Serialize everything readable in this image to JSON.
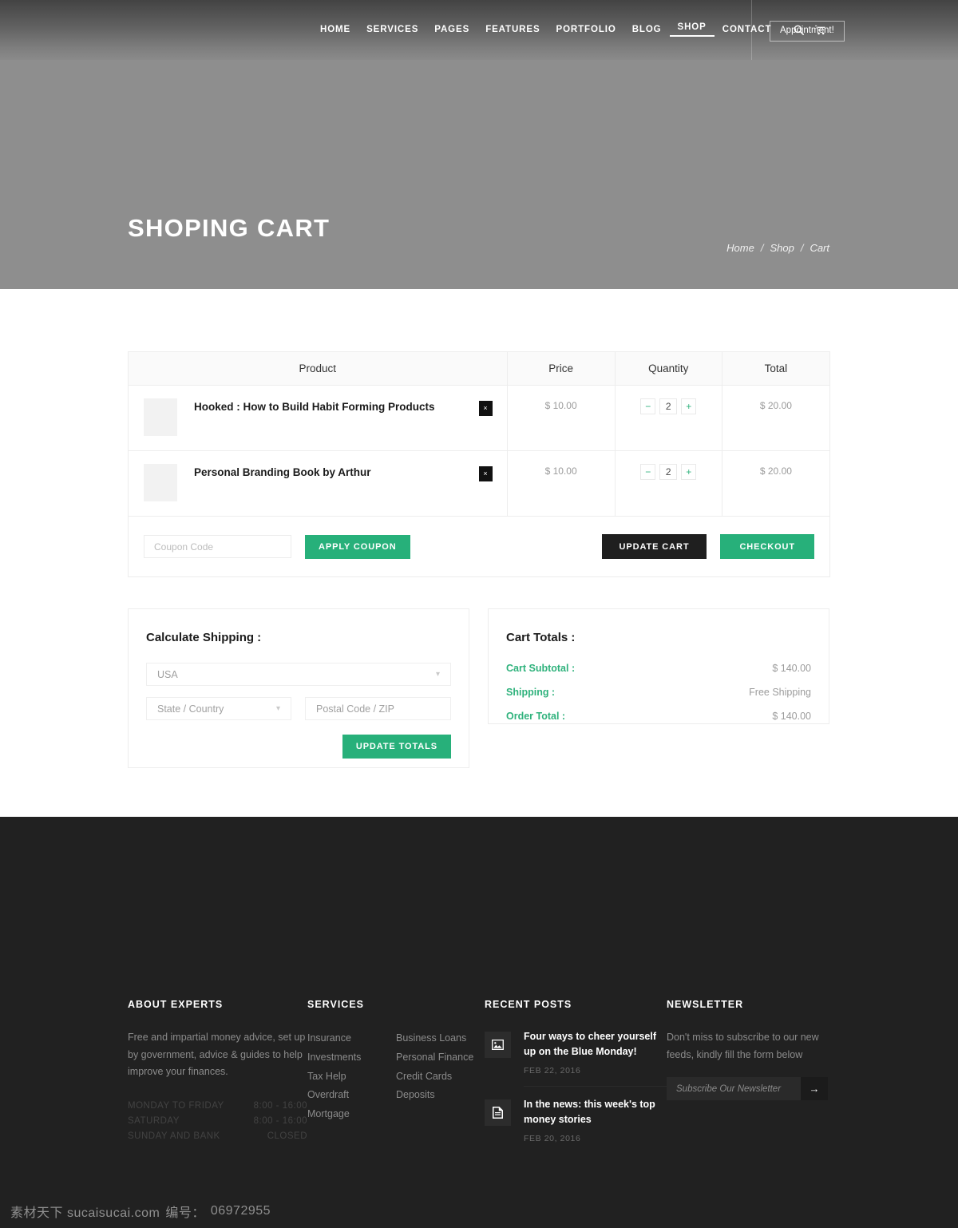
{
  "header": {
    "nav": [
      {
        "label": "HOME",
        "active": false
      },
      {
        "label": "SERVICES",
        "active": false
      },
      {
        "label": "PAGES",
        "active": false
      },
      {
        "label": "FEATURES",
        "active": false
      },
      {
        "label": "PORTFOLIO",
        "active": false
      },
      {
        "label": "BLOG",
        "active": false
      },
      {
        "label": "SHOP",
        "active": true
      },
      {
        "label": "CONTACT",
        "active": false
      }
    ],
    "search_icon": "search-icon",
    "cart_icon": "cart-icon",
    "appointment_label": "Appointment!"
  },
  "hero": {
    "title": "SHOPING CART",
    "breadcrumb": [
      {
        "label": "Home"
      },
      {
        "label": "Shop"
      },
      {
        "label": "Cart"
      }
    ],
    "separator": "/"
  },
  "cart": {
    "columns": [
      "Product",
      "Price",
      "Quantity",
      "Total"
    ],
    "items": [
      {
        "name": "Hooked : How to Build Habit Forming Products",
        "price": "$ 10.00",
        "quantity": "2",
        "total": "$ 20.00",
        "remove_label": "×",
        "decrement_label": "−",
        "increment_label": "+"
      },
      {
        "name": "Personal Branding Book by Arthur",
        "price": "$ 10.00",
        "quantity": "2",
        "total": "$ 20.00",
        "remove_label": "×",
        "decrement_label": "−",
        "increment_label": "+"
      }
    ],
    "coupon_placeholder": "Coupon Code",
    "coupon_value": "",
    "apply_coupon_label": "APPLY COUPON",
    "update_cart_label": "UPDATE CART",
    "checkout_label": "CHECKOUT"
  },
  "shipping": {
    "title": "Calculate Shipping :",
    "country_value": "USA",
    "state_value": "State / Country",
    "postal_placeholder": "Postal Code / ZIP",
    "postal_value": "",
    "update_totals_label": "UPDATE TOTALS"
  },
  "totals": {
    "title": "Cart Totals :",
    "rows": [
      {
        "label": "Cart Subtotal :",
        "value": "$ 140.00"
      },
      {
        "label": "Shipping :",
        "value": "Free Shipping"
      },
      {
        "label": "Order Total :",
        "value": "$ 140.00"
      }
    ]
  },
  "footer": {
    "about": {
      "heading": "ABOUT EXPERTS",
      "text": "Free and impartial money advice, set up by government, advice & guides to help improve your finances.",
      "hours": [
        {
          "day": "MONDAY TO FRIDAY",
          "time": "8:00 - 16:00"
        },
        {
          "day": "SATURDAY",
          "time": "8:00 - 16:00"
        },
        {
          "day": "SUNDAY AND BANK",
          "time": "CLOSED"
        }
      ]
    },
    "services": {
      "heading": "SERVICES",
      "list_left": [
        "Insurance",
        "Investments",
        "Tax Help",
        "Overdraft",
        "Mortgage"
      ],
      "list_right": [
        "Business Loans",
        "Personal Finance",
        "Credit Cards",
        "Deposits"
      ]
    },
    "posts": {
      "heading": "RECENT POSTS",
      "items": [
        {
          "title": "Four ways to cheer yourself up on the Blue Monday!",
          "date": "FEB 22, 2016",
          "icon": "image-icon"
        },
        {
          "title": "In the news: this week's top money stories",
          "date": "FEB 20, 2016",
          "icon": "document-icon"
        }
      ]
    },
    "newsletter": {
      "heading": "NEWSLETTER",
      "text": "Don't miss to subscribe to our new feeds, kindly fill the form below",
      "placeholder": "Subscribe Our Newsletter",
      "value": "",
      "submit_label": "→"
    }
  },
  "watermark": {
    "site": "素材天下 sucaisucai.com",
    "code_label": "编号：",
    "code": "06972955"
  },
  "colors": {
    "accent_green": "#27b07a",
    "dark": "#1f1f1f",
    "footer_bg": "#212121",
    "hero_bg": "#8e8e8e"
  }
}
